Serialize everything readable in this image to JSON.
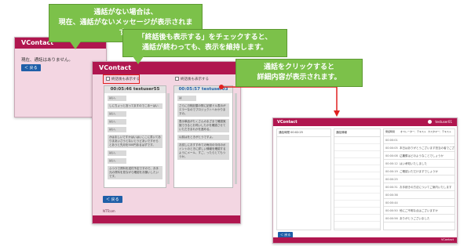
{
  "callouts": {
    "no_call": [
      "通話がない場合は、",
      "現在、通話がないメッセージが表示されます。"
    ],
    "keep_display": [
      "「終話後も表示する」をチェックすると、",
      "通話が終わっても、表示を維持します。"
    ],
    "click_call": [
      "通話をクリックすると",
      "詳細内容が表示されます。"
    ]
  },
  "window1": {
    "title": "VContact",
    "empty_message": "現在、通話はありません。",
    "back_label": "＜ 戻る"
  },
  "window2": {
    "title": "VContact",
    "keep_checkbox_label": "終話後も表示する",
    "keep_checkbox_label2": "終話後も表示する",
    "panel1_header": "00:05:46 testuser55",
    "panel2_header": "00:05:57 testuser03",
    "panel1_messages": [
      "はい。",
      "しにちょっと言ってますのでこあーはい",
      "はい。",
      "はい。",
      "はい。",
      "かはましいですかはいはいここに書いてありまあいさうとないとうどあいですからとあうと先月を500円あるはずです。",
      "はい。",
      "はい。",
      "ふつうで資料を送付予定ですので、お手元の資料を見ながら確認をお願いしたいです。"
    ],
    "panel2_messages": [
      "は",
      "さらに日程記載の際に記録ドル表示がエラーなのでプロジェクトへかかりますの。",
      "表示単品がたくさんのまざまで確認実施できるとお伺いしたかを確認させていただきまれかを進める。",
      "以前はをときがとうですよ。",
      "お試しにおすすめての毎月の今月のポイントのときに詳しい情報を確認するようにメール、すご、ったらとてもつうか。"
    ],
    "back_label": "＜ 戻る",
    "logo": "NTTcom"
  },
  "window3": {
    "title": "VContact",
    "user": "testuser01",
    "left_item": "通話時間 00:02:25",
    "center_header": "通話情報",
    "col_headers": [
      "発話時間",
      "オペレーター：テキスト",
      "カスタマー：テキスト"
    ],
    "detail_rows": [
      {
        "time": "00:00:01",
        "text": ""
      },
      {
        "time": "00:00:05",
        "text": "本日はありがとうございます担当の者でございます"
      },
      {
        "time": "00:00:08",
        "text": "ご用件はどのようなことでしょうか"
      },
      {
        "time": "00:00:12",
        "text": "はい承知いたしました"
      },
      {
        "time": "00:00:19",
        "text": "ご確認いただけますでしょうか"
      },
      {
        "time": "00:00:25",
        "text": ""
      },
      {
        "time": "00:00:31",
        "text": "お手続きの方法についてご案内いたします"
      },
      {
        "time": "00:00:38",
        "text": ""
      },
      {
        "time": "00:00:44",
        "text": ""
      },
      {
        "time": "00:00:50",
        "text": "他にご不明な点はございますか"
      },
      {
        "time": "00:00:56",
        "text": "ありがとうございました"
      }
    ],
    "center_rows": [
      "",
      "",
      "",
      "",
      "",
      "",
      "",
      "",
      "",
      "",
      "",
      "",
      ""
    ],
    "back_label": "＜ 戻る",
    "footer_label": "VContact"
  },
  "colors": {
    "brand": "#b0164f",
    "callout": "#7cc14a",
    "window_bg": "#f3d6e2",
    "back_button": "#1f5fa8",
    "highlight": "#e02020"
  }
}
